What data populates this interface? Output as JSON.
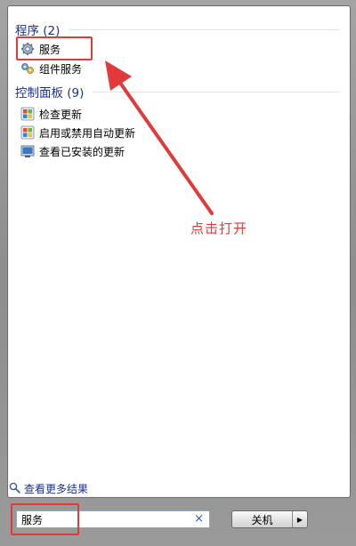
{
  "programs": {
    "header": "程序 (2)",
    "items": [
      {
        "label": "服务",
        "icon": "services-gear-icon"
      },
      {
        "label": "组件服务",
        "icon": "component-services-icon"
      }
    ]
  },
  "control_panel": {
    "header": "控制面板 (9)",
    "items": [
      {
        "label": "检查更新",
        "icon": "windows-update-icon"
      },
      {
        "label": "启用或禁用自动更新",
        "icon": "windows-update-icon"
      },
      {
        "label": "查看已安装的更新",
        "icon": "installed-updates-icon"
      }
    ]
  },
  "annotation": {
    "text": "点击打开",
    "color": "#e23a3a"
  },
  "more_results": {
    "label": "查看更多结果",
    "icon": "search-icon"
  },
  "search": {
    "value": "服务",
    "clear_icon": "×"
  },
  "shutdown": {
    "label": "关机",
    "arrow": "▶"
  },
  "colors": {
    "header": "#1e3287",
    "highlight": "#e23a3a"
  }
}
